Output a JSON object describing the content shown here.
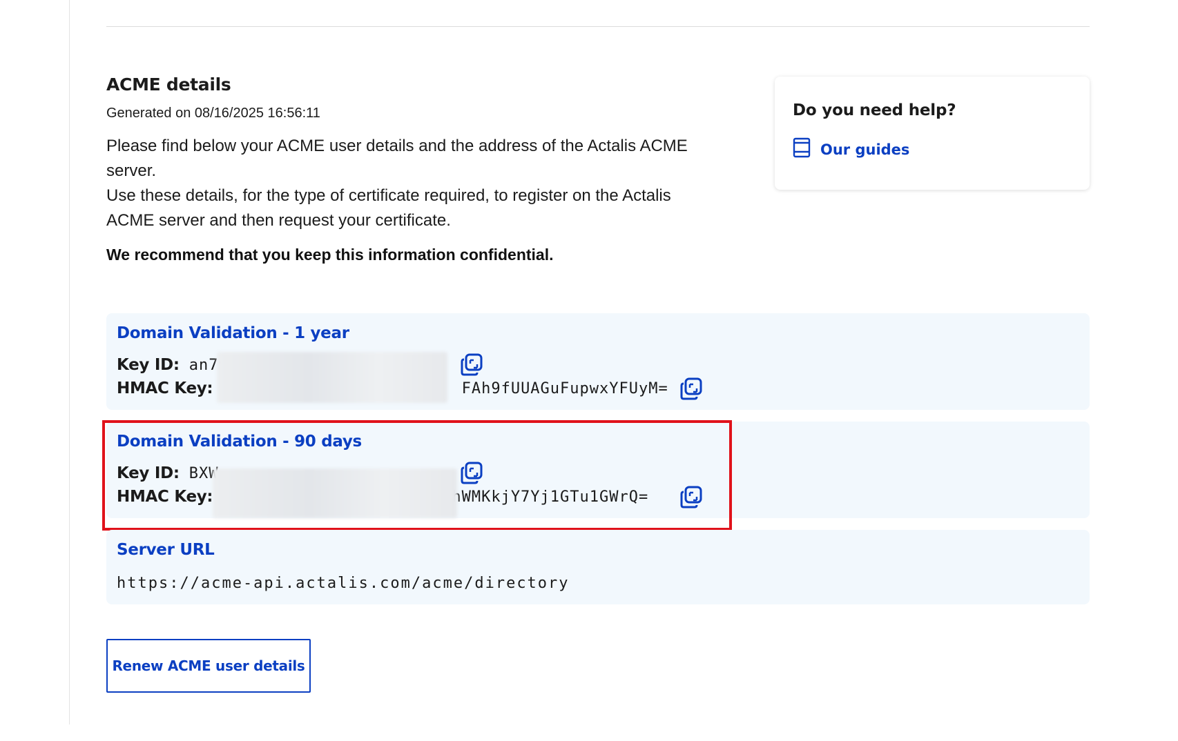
{
  "header": {
    "title": "ACME details",
    "generated": "Generated on 08/16/2025 16:56:11"
  },
  "intro": {
    "paragraph_1": "Please find below your ACME user details and the address of the Actalis ACME server.",
    "paragraph_2": "Use these details, for the type of certificate required, to register on the Actalis ACME server and then request your certificate.",
    "confidential": "We recommend that you keep this information confidential."
  },
  "help": {
    "title": "Do you need help?",
    "link_label": "Our guides",
    "icon": "book-icon"
  },
  "credentials": [
    {
      "title": "Domain Validation - 1 year",
      "key_id_label": "Key ID:",
      "key_id_visible": "an7v",
      "hmac_label": "HMAC Key:",
      "hmac_prefix": "/",
      "hmac_suffix": "FAh9fUUAGuFupwxYFUyM="
    },
    {
      "title": "Domain Validation - 90 days",
      "key_id_label": "Key ID:",
      "key_id_visible": "BXW",
      "hmac_label": "HMAC Key:",
      "hmac_prefix": "",
      "hmac_suffix": "hWMKkjY7Yj1GTu1GWrQ="
    }
  ],
  "server": {
    "title": "Server URL",
    "url": "https://acme-api.actalis.com/acme/directory"
  },
  "actions": {
    "renew_label": "Renew ACME user details"
  },
  "colors": {
    "accent": "#0b3fc2",
    "panel_bg": "#f2f8fd",
    "highlight": "#e0121b"
  }
}
